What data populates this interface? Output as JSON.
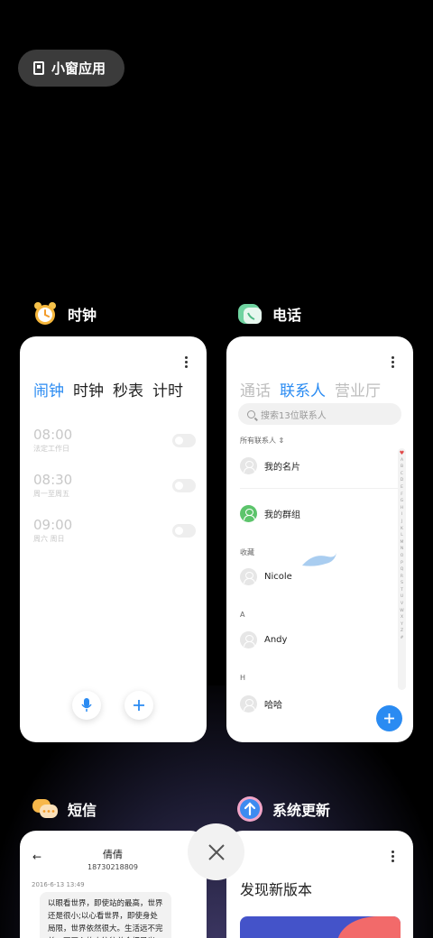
{
  "floating_window_button": {
    "label": "小窗应用",
    "icon": "window-icon"
  },
  "apps": {
    "clock": {
      "name": "时钟",
      "icon": "alarm-clock-icon",
      "tabs": [
        "闹钟",
        "时钟",
        "秒表",
        "计时"
      ],
      "active_tab": 0,
      "alarms": [
        {
          "time": "08:00",
          "repeat": "法定工作日"
        },
        {
          "time": "08:30",
          "repeat": "周一至周五"
        },
        {
          "time": "09:00",
          "repeat": "周六 周日"
        }
      ]
    },
    "phone": {
      "name": "电话",
      "icon": "phone-app-icon",
      "tabs": [
        "通话",
        "联系人",
        "营业厅"
      ],
      "active_tab": 1,
      "search_placeholder": "搜索13位联系人",
      "filter_label": "所有联系人",
      "my_card": "我的名片",
      "my_groups": "我的群组",
      "sections": [
        {
          "header": "收藏",
          "contact": "Nicole"
        },
        {
          "header": "A",
          "contact": "Andy"
        },
        {
          "header": "H",
          "contact": "哈哈"
        }
      ],
      "index_letters": [
        "A",
        "B",
        "C",
        "D",
        "E",
        "F",
        "G",
        "H",
        "I",
        "J",
        "K",
        "L",
        "M",
        "N",
        "O",
        "P",
        "Q",
        "R",
        "S",
        "T",
        "U",
        "V",
        "W",
        "X",
        "Y",
        "Z",
        "#"
      ]
    },
    "sms": {
      "name": "短信",
      "icon": "message-bubbles-icon",
      "contact_name": "倩倩",
      "contact_number": "18730218809",
      "date": "2016-6-13 13:49",
      "message": "以眼看世界，即使站的最高，世界还是很小;以心看世界，即使身处局限，世界依然很大。生活远不完美，不开心的人往往总会把目光"
    },
    "update": {
      "name": "系统更新",
      "icon": "system-update-icon",
      "title": "发现新版本"
    }
  },
  "colors": {
    "accent": "#2a8bf2",
    "background": "#000000",
    "card": "#ffffff"
  }
}
